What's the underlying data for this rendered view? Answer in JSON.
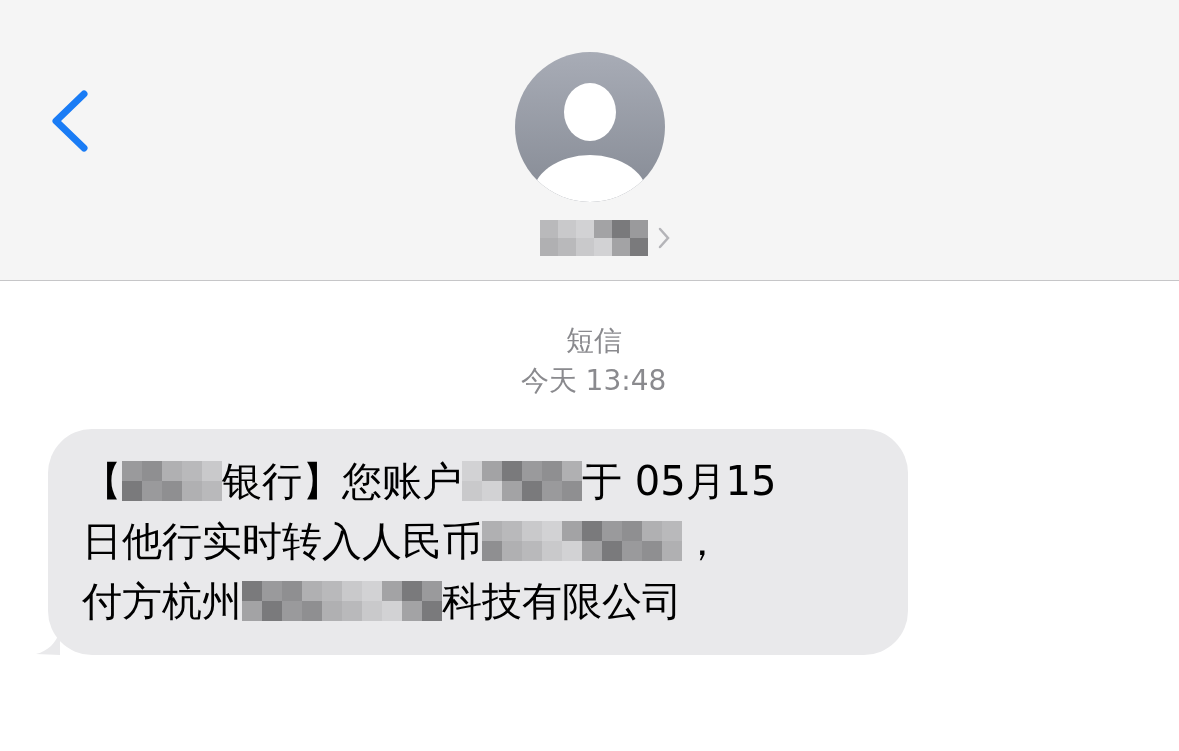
{
  "header": {
    "name": {
      "kind": "redacted"
    }
  },
  "thread": {
    "service": "短信",
    "time": "今天 13:48"
  },
  "message": {
    "lines": [
      [
        {
          "kind": "text",
          "text": "【"
        },
        {
          "kind": "redacted"
        },
        {
          "kind": "text",
          "text": "银行】您账户"
        },
        {
          "kind": "redacted"
        },
        {
          "kind": "text",
          "text": "于 05月15"
        }
      ],
      [
        {
          "kind": "text",
          "text": "日他行实时转入人民币"
        },
        {
          "kind": "redacted"
        },
        {
          "kind": "text",
          "text": "，"
        }
      ],
      [
        {
          "kind": "text",
          "text": "付方杭州"
        },
        {
          "kind": "redacted"
        },
        {
          "kind": "text",
          "text": "科技有限公司"
        }
      ]
    ]
  }
}
